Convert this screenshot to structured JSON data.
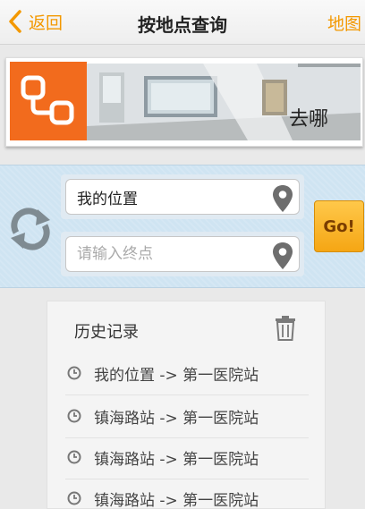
{
  "nav": {
    "back_label": "返回",
    "title": "按地点查询",
    "map_label": "地图"
  },
  "banner": {
    "text": "去哪"
  },
  "search": {
    "origin_value": "我的位置",
    "destination_placeholder": "请输入终点",
    "go_label": "Go!"
  },
  "history": {
    "title": "历史记录",
    "items": [
      {
        "label": "我的位置 -> 第一医院站"
      },
      {
        "label": "镇海路站 -> 第一医院站"
      },
      {
        "label": "镇海路站 -> 第一医院站"
      },
      {
        "label": "镇海路站 -> 第一医院站"
      }
    ]
  },
  "icons": {
    "back": "chevron-left-icon",
    "route": "route-icon",
    "swap": "swap-arrows-icon",
    "pin": "location-pin-icon",
    "trash": "trash-icon",
    "clock": "clock-icon"
  },
  "colors": {
    "accent": "#f39800",
    "logo_bg": "#f26b1d",
    "search_bg": "#cfe4f2",
    "go_button": "#f5a614"
  }
}
